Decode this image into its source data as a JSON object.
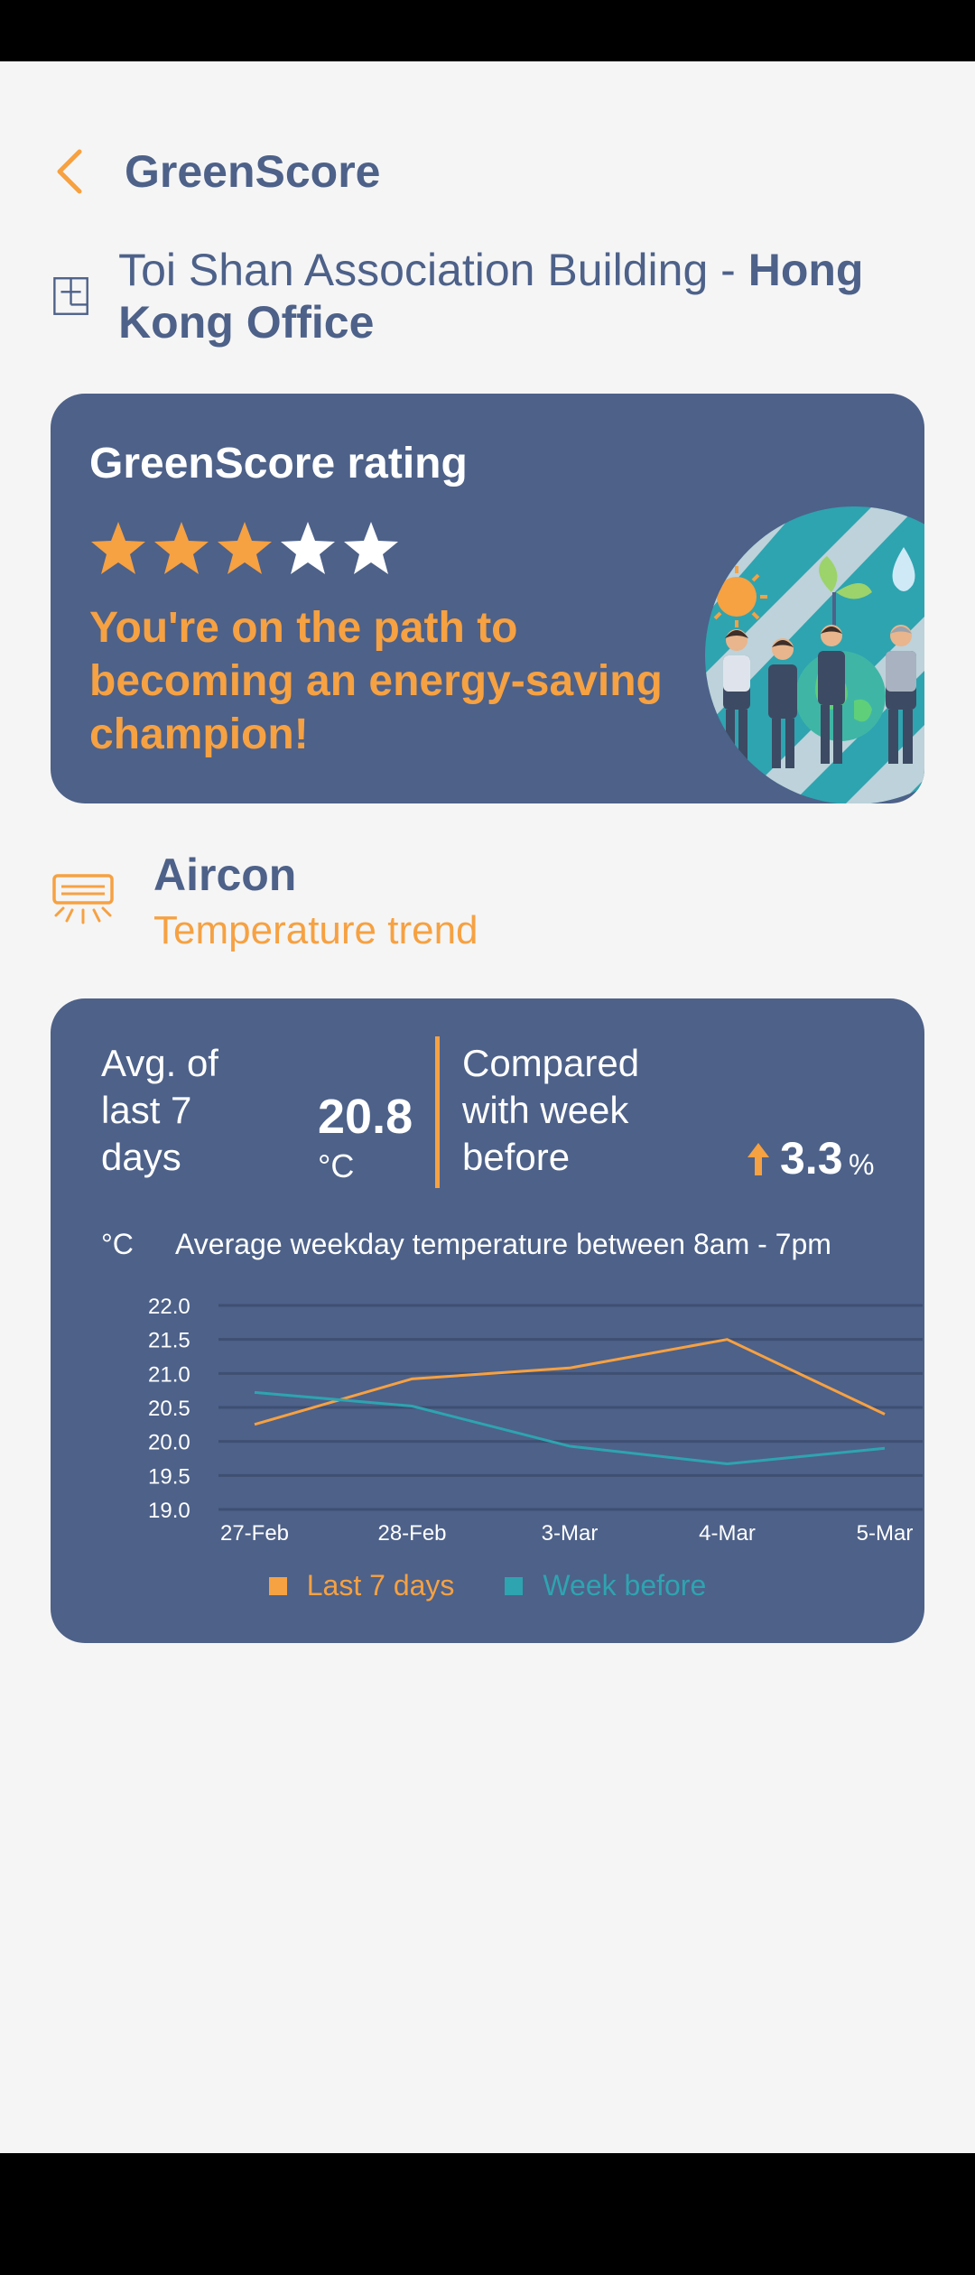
{
  "header": {
    "title": "GreenScore"
  },
  "building": {
    "name_regular": "Toi Shan Association Building - ",
    "name_bold": "Hong Kong Office"
  },
  "rating": {
    "title": "GreenScore rating",
    "stars": 3,
    "max_stars": 5,
    "message": "You're on the path to becoming an energy-saving champion!"
  },
  "section": {
    "title": "Aircon",
    "subtitle": "Temperature trend"
  },
  "summary": {
    "avg_label": "Avg. of last 7 days",
    "avg_value": "20.8",
    "avg_unit": "°C",
    "compare_label": "Compared with week before",
    "compare_value": "3.3",
    "compare_unit": "%",
    "compare_direction": "up"
  },
  "chart_data": {
    "type": "line",
    "unit_label": "°C",
    "title": "Average weekday temperature between 8am - 7pm",
    "categories": [
      "27-Feb",
      "28-Feb",
      "3-Mar",
      "4-Mar",
      "5-Mar"
    ],
    "ylim": [
      19.0,
      22.0
    ],
    "yticks": [
      "22.0",
      "21.5",
      "21.0",
      "20.5",
      "20.0",
      "19.5",
      "19.0"
    ],
    "grid": true,
    "legend": "bottom",
    "series": [
      {
        "name": "Last 7 days",
        "color": "#f6a142",
        "values": [
          20.25,
          20.92,
          21.08,
          21.5,
          20.4
        ]
      },
      {
        "name": "Week before",
        "color": "#2ea4b0",
        "values": [
          20.72,
          20.52,
          19.93,
          19.67,
          19.9
        ]
      }
    ]
  },
  "colors": {
    "card": "#4d6189",
    "accent": "#f6a142",
    "teal": "#2ea4b0",
    "text_dark": "#4d6189"
  },
  "icons": {
    "back": "chevron-left-icon",
    "building": "building-icon",
    "aircon": "aircon-icon"
  }
}
